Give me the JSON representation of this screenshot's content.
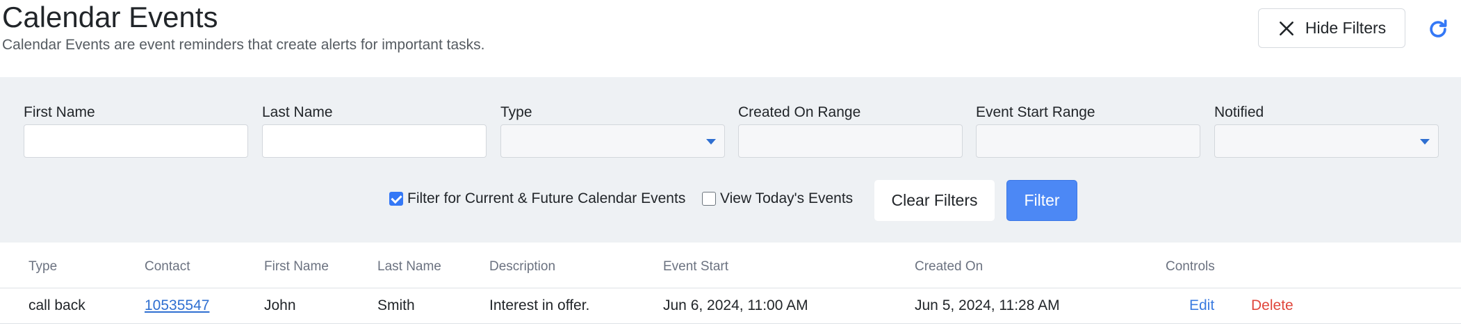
{
  "header": {
    "title": "Calendar Events",
    "subtitle": "Calendar Events are event reminders that create alerts for important tasks.",
    "hide_filters_label": "Hide Filters"
  },
  "filters": {
    "fields": [
      {
        "label": "First Name",
        "value": "",
        "type": "text"
      },
      {
        "label": "Last Name",
        "value": "",
        "type": "text"
      },
      {
        "label": "Type",
        "value": "",
        "type": "select"
      },
      {
        "label": "Created On Range",
        "value": "",
        "type": "range"
      },
      {
        "label": "Event Start Range",
        "value": "",
        "type": "range"
      },
      {
        "label": "Notified",
        "value": "",
        "type": "select"
      }
    ],
    "current_future_label": "Filter for Current & Future Calendar Events",
    "current_future_checked": true,
    "today_label": "View Today's Events",
    "today_checked": false,
    "clear_label": "Clear Filters",
    "filter_label": "Filter"
  },
  "table": {
    "columns": [
      "Type",
      "Contact",
      "First Name",
      "Last Name",
      "Description",
      "Event Start",
      "Created On",
      "Controls"
    ],
    "rows": [
      {
        "type": "call back",
        "contact": "10535547",
        "first_name": "John",
        "last_name": "Smith",
        "description": "Interest in offer.",
        "event_start": "Jun 6, 2024, 11:00 AM",
        "created_on": "Jun 5, 2024, 11:28 AM",
        "edit_label": "Edit",
        "delete_label": "Delete"
      }
    ]
  },
  "colors": {
    "accent": "#4c88f5",
    "link": "#2f6fd1",
    "danger": "#e0463b",
    "panel_bg": "#eef1f4"
  },
  "icons": {
    "hide_filters": "close-icon",
    "refresh": "refresh-icon",
    "select_caret": "caret-down-icon"
  }
}
